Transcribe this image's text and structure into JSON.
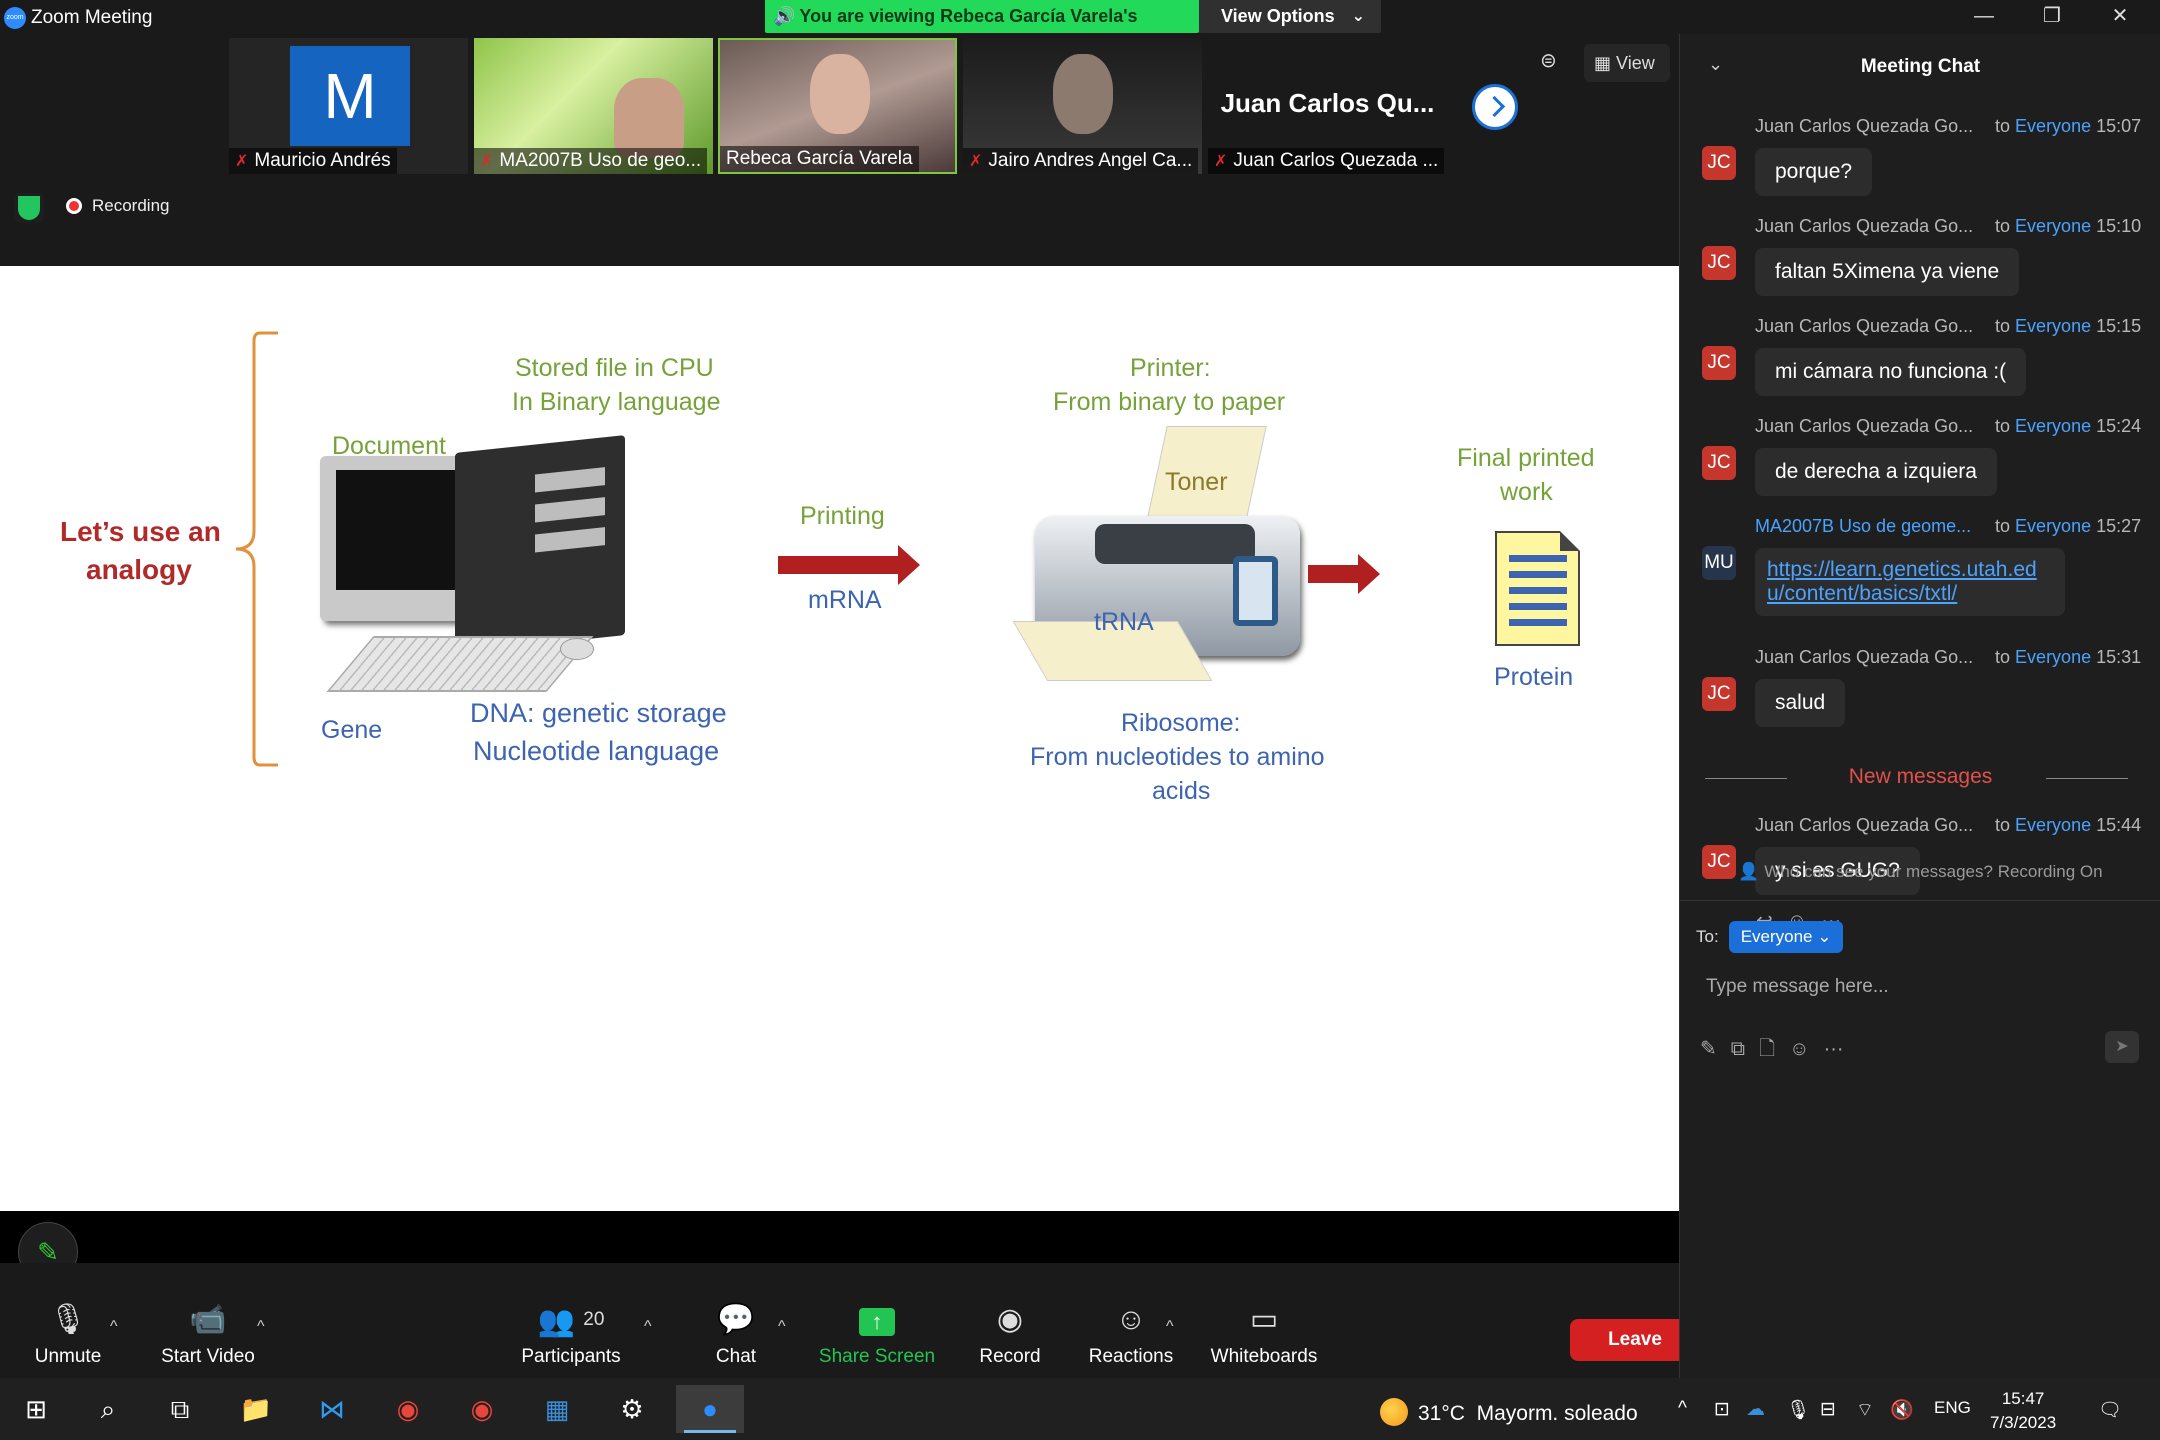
{
  "window": {
    "title": "Zoom Meeting",
    "logo_text": "zoom",
    "minimize": "—",
    "restore": "❐",
    "close": "✕"
  },
  "banner": {
    "text": "You are viewing Rebeca García Varela's screen",
    "view_options": "View Options"
  },
  "participants_strip": [
    {
      "name": "Mauricio Andrés",
      "initial": "M",
      "muted": true
    },
    {
      "name": "MA2007B Uso de geo...",
      "muted": true
    },
    {
      "name": "Rebeca García Varela",
      "muted": false,
      "active": true
    },
    {
      "name": "Jairo Andres Angel Ca...",
      "muted": true
    },
    {
      "name": "Juan Carlos Quezada ...",
      "big_name": "Juan Carlos Qu...",
      "muted": true
    }
  ],
  "top_controls": {
    "view_label": "View"
  },
  "recording": {
    "label": "Recording"
  },
  "slide": {
    "analogy": [
      "Let’s use an",
      "analogy"
    ],
    "stored_file": [
      "Stored file  in CPU",
      "In Binary language"
    ],
    "document": "Document",
    "gene": "Gene",
    "dna": [
      "DNA: genetic storage",
      "Nucleotide language"
    ],
    "printing": "Printing",
    "mrna": "mRNA",
    "printer": [
      "Printer:",
      "From binary to paper"
    ],
    "toner": "Toner",
    "trna": "tRNA",
    "ribosome": [
      "Ribosome:",
      "From nucleotides to amino",
      "acids"
    ],
    "final_work": [
      "Final printed",
      "work"
    ],
    "protein": "Protein"
  },
  "toolbar": {
    "unmute": "Unmute",
    "start_video": "Start Video",
    "participants": "Participants",
    "participants_count": "20",
    "chat": "Chat",
    "share_screen": "Share Screen",
    "record": "Record",
    "reactions": "Reactions",
    "whiteboards": "Whiteboards",
    "leave": "Leave"
  },
  "chat": {
    "title": "Meeting Chat",
    "to_prefix": "to",
    "new_messages": "New messages",
    "messages": [
      {
        "sender": "Juan Carlos Quezada Go...",
        "avatar": "JC",
        "to": "Everyone",
        "time": "15:07",
        "text": "porque?"
      },
      {
        "sender": "Juan Carlos Quezada Go...",
        "avatar": "JC",
        "to": "Everyone",
        "time": "15:10",
        "text": "faltan 5Ximena ya viene"
      },
      {
        "sender": "Juan Carlos Quezada Go...",
        "avatar": "JC",
        "to": "Everyone",
        "time": "15:15",
        "text": "mi cámara no funciona :("
      },
      {
        "sender": "Juan Carlos Quezada Go...",
        "avatar": "JC",
        "to": "Everyone",
        "time": "15:24",
        "text": "de derecha a izquiera"
      },
      {
        "sender": "MA2007B Uso de geome...",
        "avatar": "MU",
        "to": "Everyone",
        "time": "15:27",
        "link_line1": "https://learn.genetics.utah.ed",
        "link_line2": "u/content/basics/txtl/"
      },
      {
        "sender": "Juan Carlos Quezada Go...",
        "avatar": "JC",
        "to": "Everyone",
        "time": "15:31",
        "text": "salud"
      },
      {
        "sender": "Juan Carlos Quezada Go...",
        "avatar": "JC",
        "to": "Everyone",
        "time": "15:44",
        "text": "y si es GUG?"
      }
    ],
    "who_can_see": "Who can see your messages? Recording On",
    "to_label": "To:",
    "to_value": "Everyone",
    "placeholder": "Type message here..."
  },
  "taskbar": {
    "weather_temp": "31°C",
    "weather_text": "Mayorm. soleado",
    "lang": "ENG",
    "time": "15:47",
    "date": "7/3/2023"
  }
}
